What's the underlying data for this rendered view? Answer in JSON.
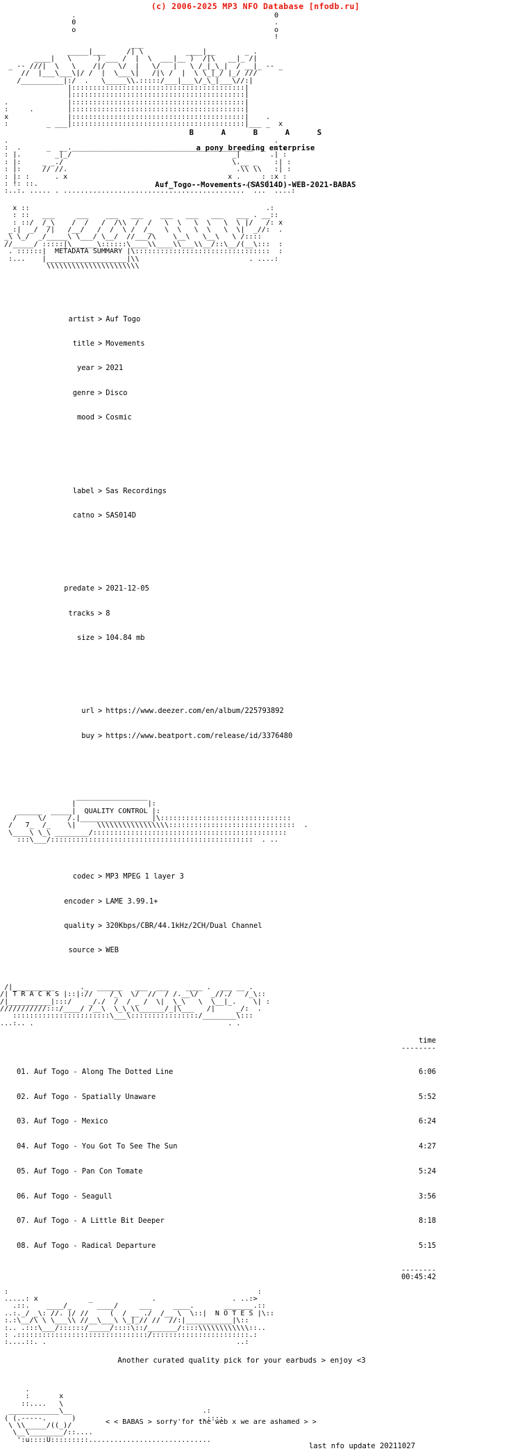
{
  "header": {
    "copyright": "(c) 2006-2025 MP3 NFO Database [nfodb.ru]",
    "copyright_color": "#e8180c"
  },
  "logo": {
    "group_letters": "B      A      B      A      S",
    "tagline": "a pony breeding enterprise",
    "art": [
      "                  .                                              0",
      "                  0                                              .",
      "                  !                                              o",
      "                                                                 !",
      "                                ___                              ",
      "                 _____|___      /|\\           ____|__        _ . ",
      "        ____|    \\      ) ___  / | \\   ___|___)  /|\\   __|__ /|  ",
      "  _ -- ///|  \\    \\    /|/   \\/  |  \\ /   |   \\ /_|_\\_|  /  ___|_ ---- _",
      "     //  |___\\___\\|/ /  |  \\___\\ |  /|\\ /  |  \\ \\_|_/ |_/ ///    ",
      "    /___________|:/  .   \\______\\:,:/___|___\\ /_\\__|___\\//      "
    ]
  },
  "release": {
    "title_line": "Auf_Togo--Movements-(SAS014D)-WEB-2021-BABAS"
  },
  "sections": {
    "metadata_title": "METADATA SUMMARY",
    "quality_title": "QUALITY CONTROL",
    "tracks_title": "T R A C K S",
    "notes_title": "N O T E S"
  },
  "metadata": {
    "separator": ">",
    "groups": [
      [
        {
          "label": "artist",
          "value": "Auf Togo"
        },
        {
          "label": "title",
          "value": "Movements"
        },
        {
          "label": "year",
          "value": "2021"
        },
        {
          "label": "genre",
          "value": "Disco"
        },
        {
          "label": "mood",
          "value": "Cosmic"
        }
      ],
      [
        {
          "label": "label",
          "value": "Sas Recordings"
        },
        {
          "label": "catno",
          "value": "SAS014D"
        }
      ],
      [
        {
          "label": "predate",
          "value": "2021-12-05"
        },
        {
          "label": "tracks",
          "value": "8"
        },
        {
          "label": "size",
          "value": "104.84 mb"
        }
      ],
      [
        {
          "label": "url",
          "value": "https://www.deezer.com/en/album/225793892"
        },
        {
          "label": "buy",
          "value": "https://www.beatport.com/release/id/3376480"
        }
      ]
    ]
  },
  "quality": {
    "separator": ">",
    "fields": [
      {
        "label": "codec",
        "value": "MP3 MPEG 1 layer 3"
      },
      {
        "label": "encoder",
        "value": "LAME 3.99.1+"
      },
      {
        "label": "quality",
        "value": "320Kbps/CBR/44.1kHz/2CH/Dual Channel"
      },
      {
        "label": "source",
        "value": "WEB"
      }
    ]
  },
  "tracks": {
    "time_header": "time",
    "time_rule": "--------",
    "total": "00:45:42",
    "items": [
      {
        "num": "01.",
        "artist": "Auf Togo",
        "title": "Along The Dotted Line",
        "time": "6:06"
      },
      {
        "num": "02.",
        "artist": "Auf Togo",
        "title": "Spatially Unaware",
        "time": "5:52"
      },
      {
        "num": "03.",
        "artist": "Auf Togo",
        "title": "Mexico",
        "time": "6:24"
      },
      {
        "num": "04.",
        "artist": "Auf Togo",
        "title": "You Got To See The Sun",
        "time": "4:27"
      },
      {
        "num": "05.",
        "artist": "Auf Togo",
        "title": "Pan Con Tomate",
        "time": "5:24"
      },
      {
        "num": "06.",
        "artist": "Auf Togo",
        "title": "Seagull",
        "time": "3:56"
      },
      {
        "num": "07.",
        "artist": "Auf Togo",
        "title": "A Little Bit Deeper",
        "time": "8:18"
      },
      {
        "num": "08.",
        "artist": "Auf Togo",
        "title": "Radical Departure",
        "time": "5:15"
      }
    ]
  },
  "notes": {
    "text": "Another curated quality pick for your earbuds > enjoy <3"
  },
  "footer": {
    "signature": "< < BABAS > sorry for the web x we are ashamed > >",
    "last_update": "last nfo update 20211027"
  },
  "ascii": {
    "logo_top": "                 .                                               0\n                 0                                               .\n                 o                                               o\n                                                                 !",
    "metadata_banner": "    x ::   ___      ___   ___   ___    ___   ___    ___  ___ .  __::\n    : ::/  /_\\    /  /   /  /\\\\   /  /   \\  \\   \\  \\  \\  |/   /:\n   _:|  _/   /|  /__/   /  /  \\  /  /_   \\  \\   \\  \\  \\  |  _//: x\n  _\\ \\_/  _/_____\\ \\__\\/ \\__/  / /___/\\   \\__\\   \\__\\  \\  /::::  .\n //_____/ |:::::::|          \\\\___\\:::::\\___\\\\___\\/::\\__/(__\\:::  :\n  . :::::::|  METADATA SUMMARY |\\:::::::::::::::::::::::::::::::::  :\n  :...     |__________________|\\\\                          . ....:",
    "quality_banner": "                    ________________\n                   |                |\\\n     _______  ____ |  QUALITY CONTROL|\\\n   /      \\/    /. |________________|\\:::::::::::::::::::::::::::::\n  /   7_  /_   \\|      \\\\\\\\\\\\\\\\\\\\\\\\\\\\\\\\:::::::::::::::::::::::::::::  .\n  \\____\\ \\_\\ _______/::::::::::::::::::::::::::::::::::::::::::::::\n     :::\\___/:::::::::::::::::::::::::::::::::::::::::::::::::::  :",
    "tracks_banner": " /|________   .____________  ____ ___ .  ___ __ .\n/| T R A C K S |://    /_\\  \\/  //  /.__\\ /  _//./   /_\\::\n/|__________|::/    _/./  /  _ /  \\|  \\ \\   \\__|_.   \\| :\n///////////::/____/ /__\\ \\_\\__\\\\______/_|\\___  /|    _/: .\n   ::::::::::::::::::::::::\\___\\::::::::::::::/_______\\:::",
    "notes_banner": " :                                                      :\n .....: x              _               .             . ..:>\n   .::.     ____/_     ____/      ___    ____.::|\n ..:._/ _\\:  //. |/ //    (  /  __ ./ /__ \\::| N O T E S |\\::\n :.:\\__/\\ \\  \\___\\\\  //__\\___\\ \\_|_// //:|__________|\\::\n :.. .:::\\___/::::::/_____/:::::\\::/_______/::::\\\\\\\\\\\\\\\\\\::..\n : .:::::::::::::::::::::::::::::::::/:::::::::::::::::::.:\n :....::. .                                            ..:",
    "footer_art": "      .\n      :      x\n     ::....  \\\n  ___________\\__\n ( (.-----.   )\n  \\ \\\\____/((_)/",
    "footer_art_tail": "   \\__\\_______/::....\n    ':u::::U:::::::::.............................."
  }
}
